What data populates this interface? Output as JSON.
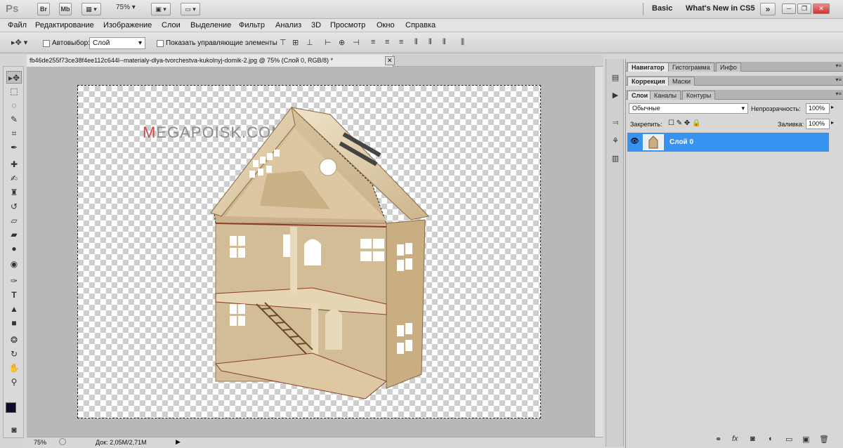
{
  "app": {
    "logo": "Ps",
    "bridge": "Br",
    "minibridge": "Mb",
    "zoom": "75%",
    "workspace": "Basic",
    "whats_new": "What's New in CS5",
    "expand": "»"
  },
  "window_buttons": [
    "─",
    "❐",
    "✕"
  ],
  "menu": [
    "Файл",
    "Редактирование",
    "Изображение",
    "Слои",
    "Выделение",
    "Фильтр",
    "Анализ",
    "3D",
    "Просмотр",
    "Окно",
    "Справка"
  ],
  "options": {
    "autoselect_label": "Автовыбор:",
    "autoselect_value": "Слой",
    "show_controls_label": "Показать управляющие элементы"
  },
  "document": {
    "tab_title": "fb46de255f73ce38f4ee112c644l--materialy-dlya-tvorchestva-kukolnyj-domik-2.jpg @ 75% (Слой 0, RGB/8) *",
    "close": "✕"
  },
  "watermark": {
    "first": "M",
    "rest": "EGAPOISK.COM"
  },
  "status": {
    "zoom": "75%",
    "doc_info": "Док: 2,05M/2,71M",
    "arrow": "▶"
  },
  "panels": {
    "group1_tabs": [
      "Навигатор",
      "Гистограмма",
      "Инфо"
    ],
    "group2_tabs": [
      "Коррекция",
      "Маски"
    ],
    "group3_tabs": [
      "Слои",
      "Каналы",
      "Контуры"
    ],
    "blend_mode": "Обычные",
    "opacity_label": "Непрозрачность:",
    "opacity_value": "100%",
    "lock_label": "Закрепить:",
    "fill_label": "Заливка:",
    "fill_value": "100%",
    "layer_name": "Слой 0"
  },
  "colors": {
    "selection": "#3793ef",
    "watermark_accent": "#c74b4b"
  }
}
